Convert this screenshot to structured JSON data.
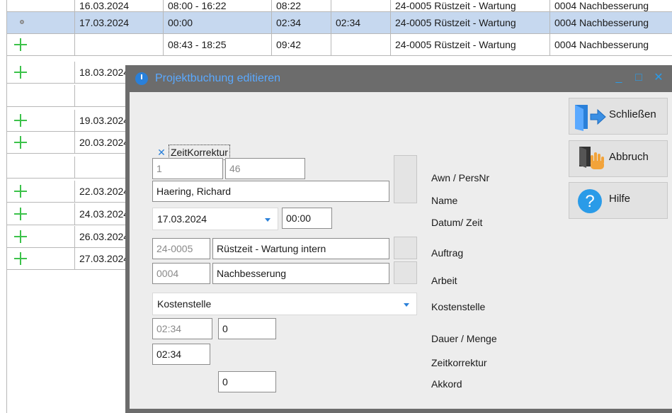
{
  "grid": {
    "top_row": {
      "date": "16.03.2024",
      "time": "08:00 - 16:22",
      "duration": "08:22",
      "booking": "24-0005 Rüstzeit - Wartung",
      "work": "0004 Nachbesserung"
    },
    "rows": [
      {
        "icon": "dot",
        "date": "17.03.2024",
        "time": "00:00",
        "duration": "02:34",
        "correction": "02:34",
        "booking": "24-0005 Rüstzeit - Wartung",
        "work": "0004 Nachbesserung",
        "selected": true
      },
      {
        "icon": "plus",
        "date": "",
        "time": "08:43 - 18:25",
        "duration": "09:42",
        "correction": "",
        "booking": "24-0005 Rüstzeit - Wartung",
        "work": "0004 Nachbesserung"
      },
      {
        "icon": "plus",
        "date": "18.03.2024"
      },
      {
        "icon": "",
        "date": ""
      },
      {
        "icon": "plus",
        "date": "19.03.2024"
      },
      {
        "icon": "plus",
        "date": "20.03.2024"
      },
      {
        "icon": "",
        "date": ""
      },
      {
        "icon": "plus",
        "date": "22.03.2024"
      },
      {
        "icon": "plus",
        "date": "24.03.2024"
      },
      {
        "icon": "plus",
        "date": "26.03.2024"
      },
      {
        "icon": "plus",
        "date": "27.03.2024"
      }
    ]
  },
  "dialog": {
    "title": "Projektbuchung editieren",
    "minimize": "_",
    "maximize": "□",
    "close": "✕",
    "checkbox": {
      "label": "ZeitKorrektur",
      "mark": "✕",
      "checked": true
    },
    "awn": "1",
    "persnr": "46",
    "name": "Haering, Richard",
    "date": "17.03.2024",
    "time": "00:00",
    "auftrag_nr": "24-0005",
    "auftrag_text": "Rüstzeit - Wartung intern",
    "arbeit_nr": "0004",
    "arbeit_text": "Nachbesserung",
    "kostenstelle": "Kostenstelle",
    "dauer": "02:34",
    "menge": "0",
    "zeitkorrektur": "02:34",
    "akkord": "0",
    "labels": {
      "awn": "Awn / PersNr",
      "name": "Name",
      "datum": "Datum/ Zeit",
      "auftrag": "Auftrag",
      "arbeit": "Arbeit",
      "kostenstelle": "Kostenstelle",
      "dauer": "Dauer / Menge",
      "zeitkorrektur": "Zeitkorrektur",
      "akkord": "Akkord"
    },
    "buttons": {
      "close": "Schließen",
      "cancel": "Abbruch",
      "help": "Hilfe"
    }
  }
}
